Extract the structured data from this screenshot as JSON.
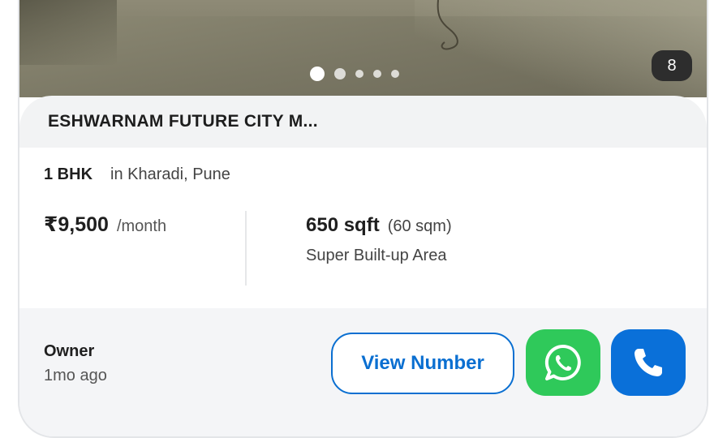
{
  "gallery": {
    "photo_count": "8",
    "total_dots": 5,
    "active_dot": 0
  },
  "listing": {
    "title": "ESHWARNAM FUTURE CITY M...",
    "type": "1 BHK",
    "location": "in Kharadi, Pune",
    "price": "₹9,500",
    "price_period": "/month",
    "area": "650 sqft",
    "area_alt": "(60 sqm)",
    "area_label": "Super Built-up Area"
  },
  "footer": {
    "posted_by": "Owner",
    "posted_ago": "1mo ago",
    "view_number_label": "View Number",
    "whatsapp_icon": "whatsapp-icon",
    "call_icon": "phone-icon"
  },
  "colors": {
    "primary": "#0a6fd1",
    "whatsapp": "#2fc95a",
    "call": "#0a70d9"
  }
}
